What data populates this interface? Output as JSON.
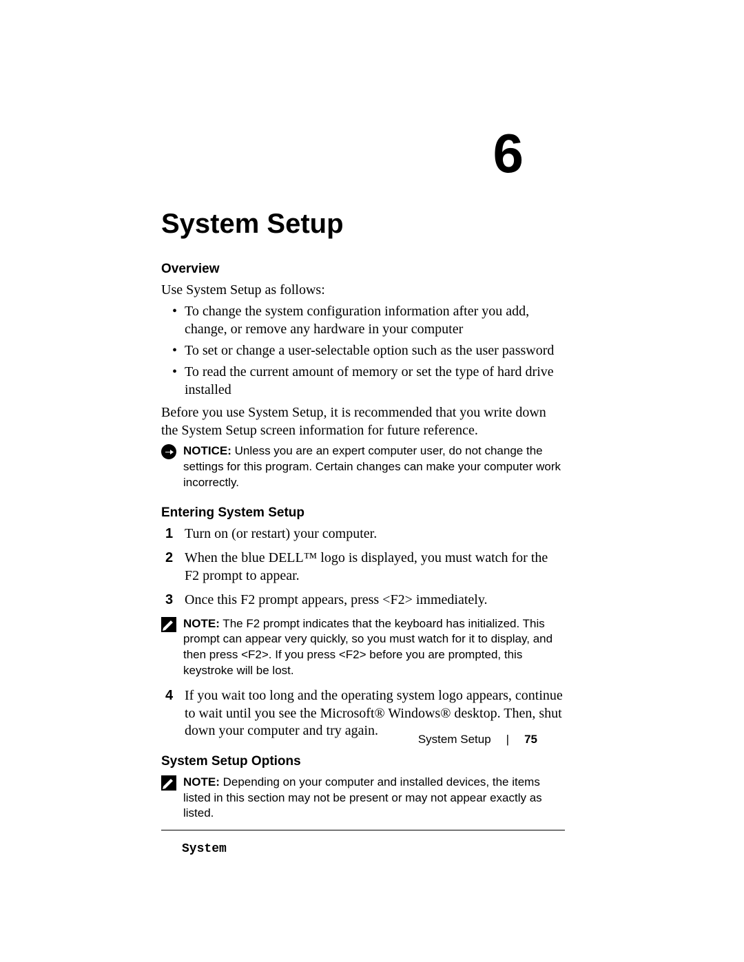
{
  "chapter_number": "6",
  "title": "System Setup",
  "overview": {
    "heading": "Overview",
    "intro": "Use System Setup as follows:",
    "bullets": [
      "To change the system configuration information after you add, change, or remove any hardware in your computer",
      "To set or change a user-selectable option such as the user password",
      "To read the current amount of memory or set the type of hard drive installed"
    ],
    "after": "Before you use System Setup, it is recommended that you write down the System Setup screen information for future reference.",
    "notice_lead": "NOTICE:",
    "notice_body": " Unless you are an expert computer user, do not change the settings for this program. Certain changes can make your computer work incorrectly."
  },
  "entering": {
    "heading": "Entering System Setup",
    "steps": [
      "Turn on (or restart) your computer.",
      "When the blue DELL™ logo is displayed, you must watch for the F2 prompt to appear.",
      "Once this F2 prompt appears, press <F2> immediately."
    ],
    "note_lead": "NOTE:",
    "note_body": " The F2 prompt indicates that the keyboard has initialized. This prompt can appear very quickly, so you must watch for it to display, and then press <F2>. If you press <F2> before you are prompted, this keystroke will be lost.",
    "step4": "If you wait too long and the operating system logo appears, continue to wait until you see the Microsoft® Windows® desktop. Then, shut down your computer and try again."
  },
  "options": {
    "heading": "System Setup Options",
    "note_lead": "NOTE:",
    "note_body": " Depending on your computer and installed devices, the items listed in this section may not be present or may not appear exactly as listed.",
    "box_title": "System"
  },
  "footer": {
    "label": "System Setup",
    "page": "75"
  }
}
